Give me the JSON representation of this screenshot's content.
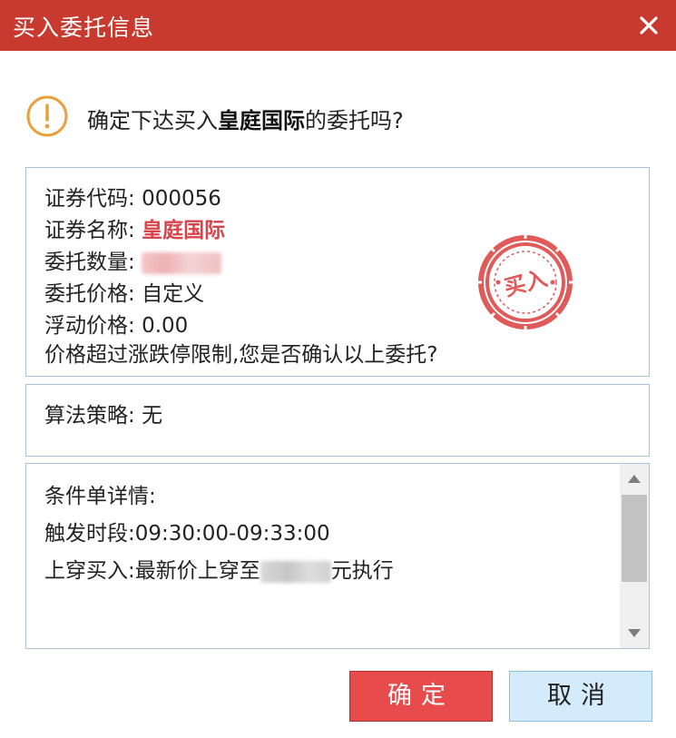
{
  "window": {
    "title": "买入委托信息",
    "close_icon": "close-icon"
  },
  "confirm": {
    "icon": "warning-icon",
    "prefix": "确定下达买入",
    "stock_name": "皇庭国际",
    "suffix": "的委托吗?"
  },
  "order_info": {
    "code_label": "证券代码:",
    "code_value": "000056",
    "name_label": "证券名称:",
    "name_value": "皇庭国际",
    "qty_label": "委托数量:",
    "price_label": "委托价格:",
    "price_value": "自定义",
    "float_label": "浮动价格:",
    "float_value": "0.00",
    "warning": "价格超过涨跌停限制,您是否确认以上委托?",
    "stamp_text": "买入"
  },
  "algo": {
    "label": "算法策略:",
    "value": "无"
  },
  "condition": {
    "title": "条件单详情:",
    "trigger": "触发时段:09:30:00-09:33:00",
    "rule_prefix": "上穿买入:最新价上穿至",
    "rule_suffix": "元执行"
  },
  "buttons": {
    "ok": "确定",
    "cancel": "取消"
  },
  "colors": {
    "titlebar": "#c8392f",
    "accent_red": "#d9434a",
    "ok_button": "#e84b4b",
    "cancel_button": "#d4ebfb",
    "warning_orange": "#e6a23c",
    "box_border": "#a9c3dd"
  }
}
